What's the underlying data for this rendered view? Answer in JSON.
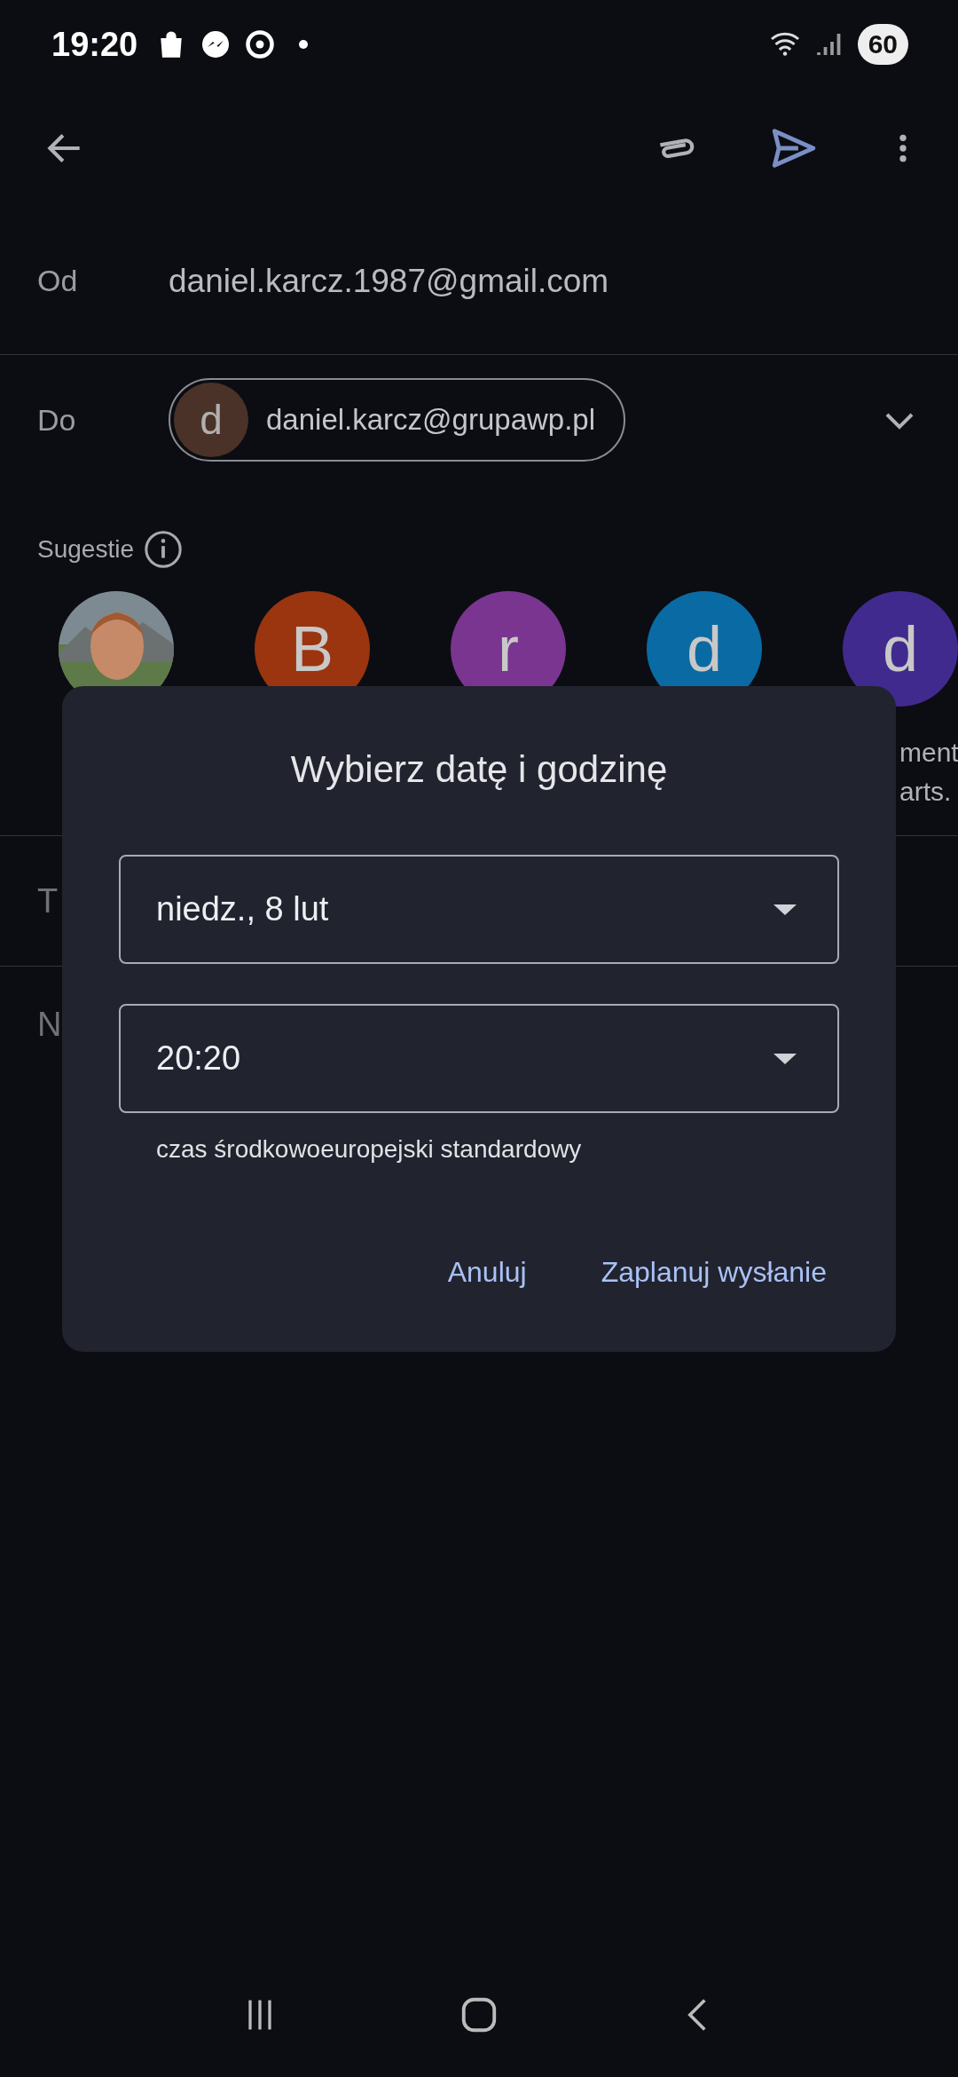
{
  "status_bar": {
    "time": "19:20",
    "battery": "60"
  },
  "from": {
    "label": "Od",
    "value": "daniel.karcz.1987@gmail.com"
  },
  "to": {
    "label": "Do",
    "chips": [
      {
        "initial": "d",
        "email": "daniel.karcz@grupawp.pl",
        "color": "#4a3229"
      }
    ]
  },
  "suggestions": {
    "label": "Sugestie",
    "contacts": [
      {
        "kind": "picture"
      },
      {
        "kind": "initial",
        "initial": "B",
        "color": "#9a350f"
      },
      {
        "kind": "initial",
        "initial": "r",
        "color": "#7a3590"
      },
      {
        "kind": "initial",
        "initial": "d",
        "color": "#0a6aa3"
      },
      {
        "kind": "initial",
        "initial": "d",
        "color": "#412a8e"
      }
    ],
    "name_lines": [
      "ment",
      "arts."
    ]
  },
  "subject": {
    "placeholder": "T"
  },
  "body": {
    "placeholder": "N"
  },
  "dialog": {
    "title": "Wybierz datę i godzinę",
    "date": "niedz., 8 lut",
    "time": "20:20",
    "timezone": "czas środkowoeuropejski standardowy",
    "buttons": [
      {
        "label": "Anuluj"
      },
      {
        "label": "Zaplanuj wysłanie"
      }
    ]
  }
}
